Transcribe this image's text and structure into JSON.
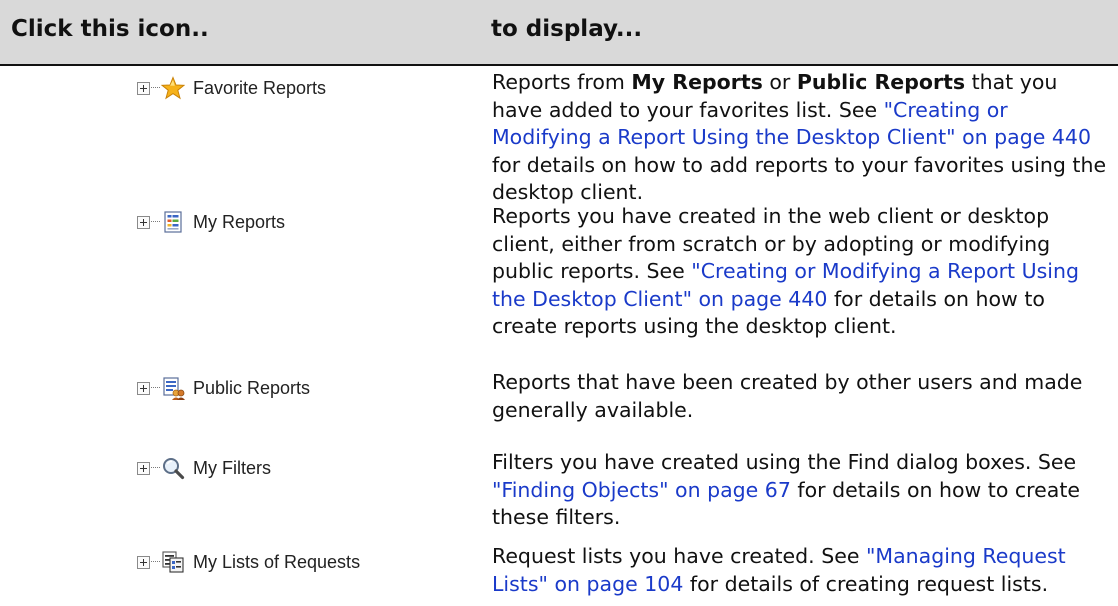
{
  "header": {
    "col1": "Click this icon..",
    "col2": "to display..."
  },
  "rows": [
    {
      "label": "Favorite Reports",
      "icon": "star-icon",
      "t1": "Reports from ",
      "b1": "My Reports",
      "t2": " or ",
      "b2": "Public Reports",
      "t3": " that you have added to your favorites list. See ",
      "link": "\"Creating or Modifying a Report Using the Desktop Client\" on page 440",
      "t4": " for details on how to add reports to your favorites using the desktop client."
    },
    {
      "label": "My Reports",
      "icon": "report-icon",
      "t1": "Reports you have created in the web client or desktop client, either from scratch or by adopting or modifying public reports. See ",
      "link": "\"Creating or Modifying a Report Using the Desktop Client\" on page 440",
      "t2": " for details on how to create reports using the desktop client."
    },
    {
      "label": "Public Reports",
      "icon": "public-reports-icon",
      "t1": "Reports that have been created by other users and made generally available."
    },
    {
      "label": "My Filters",
      "icon": "magnifier-icon",
      "t1": "Filters you have created using the Find dialog boxes. See ",
      "link": "\"Finding Objects\" on page 67",
      "t2": " for details on how to create these filters."
    },
    {
      "label": "My Lists of Requests",
      "icon": "request-list-icon",
      "t1": "Request lists you have created. See ",
      "link": "\"Managing Request Lists\" on page 104",
      "t2": " for details of creating request lists."
    }
  ]
}
